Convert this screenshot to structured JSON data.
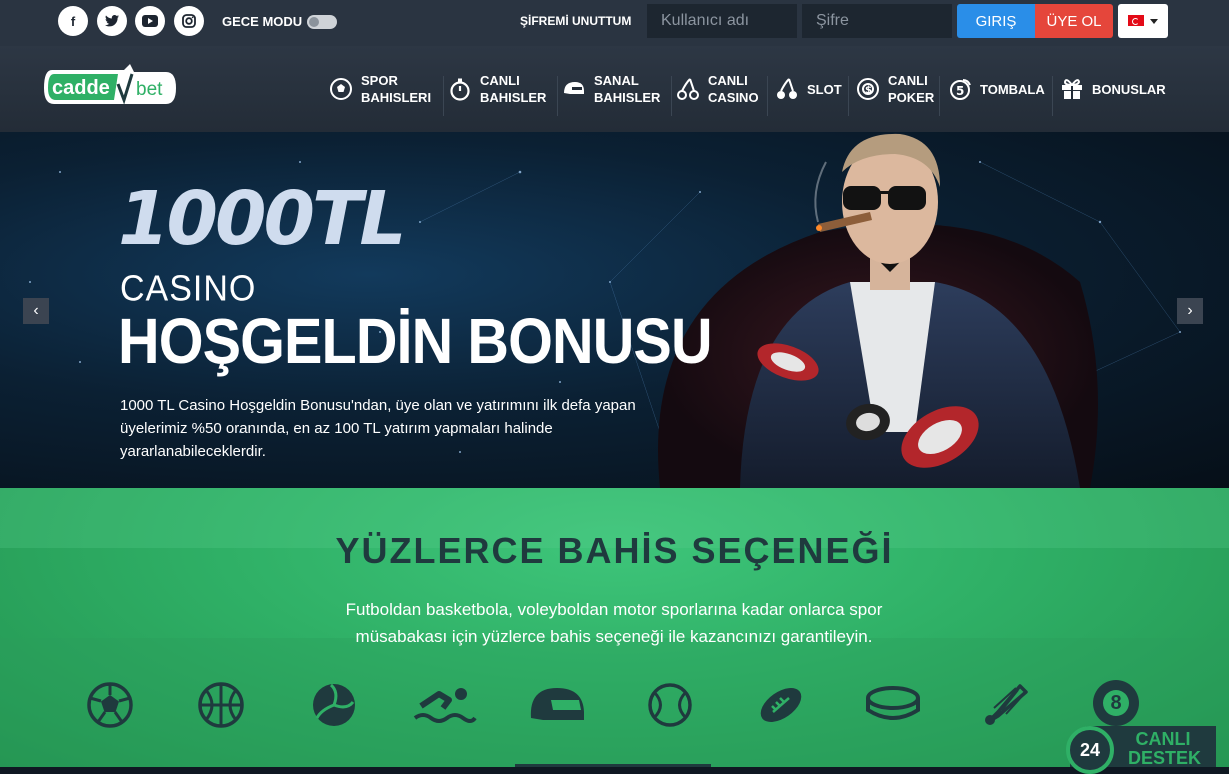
{
  "topbar": {
    "social": [
      {
        "name": "facebook",
        "glyph": "f"
      },
      {
        "name": "twitter",
        "glyph": "t"
      },
      {
        "name": "youtube",
        "glyph": "▶"
      },
      {
        "name": "instagram",
        "glyph": "◎"
      }
    ],
    "night_mode_label": "GECE MODU",
    "forgot_password": "ŞİFREMİ UNUTTUM",
    "username_placeholder": "Kullanıcı adı",
    "password_placeholder": "Şifre",
    "login_label": "GIRIŞ",
    "register_label": "ÜYE OL",
    "language": "TR"
  },
  "nav": {
    "logo_left": "cadde",
    "logo_right": "bet",
    "items": [
      {
        "line1": "SPOR",
        "line2": "BAHISLERI",
        "icon": "soccer-ball-icon"
      },
      {
        "line1": "CANLI",
        "line2": "BAHISLER",
        "icon": "stopwatch-icon"
      },
      {
        "line1": "SANAL",
        "line2": "BAHISLER",
        "icon": "helmet-icon"
      },
      {
        "line1": "CANLI",
        "line2": "CASINO",
        "icon": "cherries-icon"
      },
      {
        "line1": "SLOT",
        "line2": "",
        "icon": "cherries-icon"
      },
      {
        "line1": "CANLI",
        "line2": "POKER",
        "icon": "poker-chip-icon"
      },
      {
        "line1": "TOMBALA",
        "line2": "",
        "icon": "lottery-ball-icon"
      },
      {
        "line1": "BONUSLAR",
        "line2": "",
        "icon": "gift-icon"
      }
    ]
  },
  "hero": {
    "title": "1000TL",
    "subtitle_small": "CASINO",
    "subtitle_big": "HOŞGELDİN BONUSU",
    "description": "1000 TL Casino Hoşgeldin Bonusu'ndan, üye olan ve yatırımını ilk defa yapan üyelerimiz %50 oranında, en az 100 TL yatırım yapmaları halinde yararlanabileceklerdir.",
    "prev_arrow": "‹",
    "next_arrow": "›"
  },
  "sports": {
    "title": "YÜZLERCE BAHİS SEÇENEĞİ",
    "description": "Futboldan basketbola, voleyboldan motor sporlarına kadar onlarca spor müsabakası için yüzlerce bahis seçeneği ile kazancınızı garantileyin.",
    "icons": [
      "soccer-icon",
      "basketball-icon",
      "volleyball-icon",
      "swimming-icon",
      "motorsport-helmet-icon",
      "tennis-icon",
      "american-football-icon",
      "ice-hockey-puck-icon",
      "badminton-icon",
      "billiards-8-ball-icon"
    ],
    "eight_ball_label": "8"
  },
  "support": {
    "badge": "24",
    "line1": "CANLI",
    "line2": "DESTEK"
  },
  "colors": {
    "topbar_bg": "#2a3441",
    "login_blue": "#2a8ee8",
    "register_red": "#e5463b",
    "brand_green": "#2fb066",
    "dark_teal": "#1f3a3e"
  }
}
